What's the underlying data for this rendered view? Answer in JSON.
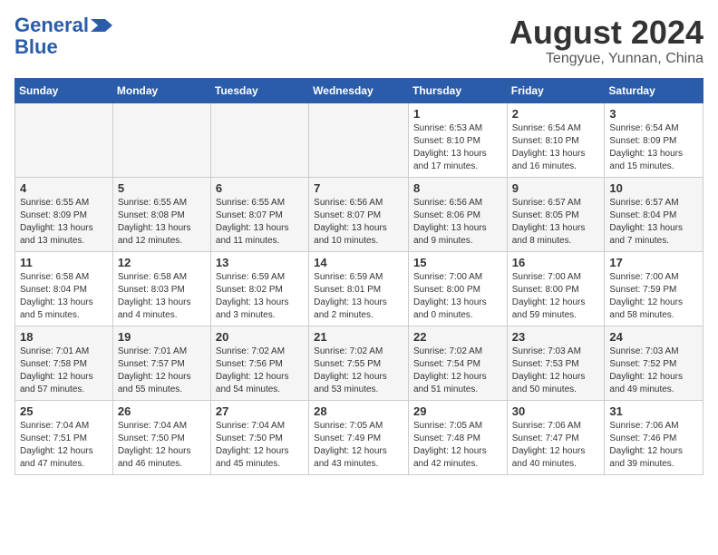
{
  "header": {
    "logo_line1": "General",
    "logo_line2": "Blue",
    "title": "August 2024",
    "subtitle": "Tengyue, Yunnan, China"
  },
  "weekdays": [
    "Sunday",
    "Monday",
    "Tuesday",
    "Wednesday",
    "Thursday",
    "Friday",
    "Saturday"
  ],
  "weeks": [
    [
      {
        "day": "",
        "info": ""
      },
      {
        "day": "",
        "info": ""
      },
      {
        "day": "",
        "info": ""
      },
      {
        "day": "",
        "info": ""
      },
      {
        "day": "1",
        "info": "Sunrise: 6:53 AM\nSunset: 8:10 PM\nDaylight: 13 hours\nand 17 minutes."
      },
      {
        "day": "2",
        "info": "Sunrise: 6:54 AM\nSunset: 8:10 PM\nDaylight: 13 hours\nand 16 minutes."
      },
      {
        "day": "3",
        "info": "Sunrise: 6:54 AM\nSunset: 8:09 PM\nDaylight: 13 hours\nand 15 minutes."
      }
    ],
    [
      {
        "day": "4",
        "info": "Sunrise: 6:55 AM\nSunset: 8:09 PM\nDaylight: 13 hours\nand 13 minutes."
      },
      {
        "day": "5",
        "info": "Sunrise: 6:55 AM\nSunset: 8:08 PM\nDaylight: 13 hours\nand 12 minutes."
      },
      {
        "day": "6",
        "info": "Sunrise: 6:55 AM\nSunset: 8:07 PM\nDaylight: 13 hours\nand 11 minutes."
      },
      {
        "day": "7",
        "info": "Sunrise: 6:56 AM\nSunset: 8:07 PM\nDaylight: 13 hours\nand 10 minutes."
      },
      {
        "day": "8",
        "info": "Sunrise: 6:56 AM\nSunset: 8:06 PM\nDaylight: 13 hours\nand 9 minutes."
      },
      {
        "day": "9",
        "info": "Sunrise: 6:57 AM\nSunset: 8:05 PM\nDaylight: 13 hours\nand 8 minutes."
      },
      {
        "day": "10",
        "info": "Sunrise: 6:57 AM\nSunset: 8:04 PM\nDaylight: 13 hours\nand 7 minutes."
      }
    ],
    [
      {
        "day": "11",
        "info": "Sunrise: 6:58 AM\nSunset: 8:04 PM\nDaylight: 13 hours\nand 5 minutes."
      },
      {
        "day": "12",
        "info": "Sunrise: 6:58 AM\nSunset: 8:03 PM\nDaylight: 13 hours\nand 4 minutes."
      },
      {
        "day": "13",
        "info": "Sunrise: 6:59 AM\nSunset: 8:02 PM\nDaylight: 13 hours\nand 3 minutes."
      },
      {
        "day": "14",
        "info": "Sunrise: 6:59 AM\nSunset: 8:01 PM\nDaylight: 13 hours\nand 2 minutes."
      },
      {
        "day": "15",
        "info": "Sunrise: 7:00 AM\nSunset: 8:00 PM\nDaylight: 13 hours\nand 0 minutes."
      },
      {
        "day": "16",
        "info": "Sunrise: 7:00 AM\nSunset: 8:00 PM\nDaylight: 12 hours\nand 59 minutes."
      },
      {
        "day": "17",
        "info": "Sunrise: 7:00 AM\nSunset: 7:59 PM\nDaylight: 12 hours\nand 58 minutes."
      }
    ],
    [
      {
        "day": "18",
        "info": "Sunrise: 7:01 AM\nSunset: 7:58 PM\nDaylight: 12 hours\nand 57 minutes."
      },
      {
        "day": "19",
        "info": "Sunrise: 7:01 AM\nSunset: 7:57 PM\nDaylight: 12 hours\nand 55 minutes."
      },
      {
        "day": "20",
        "info": "Sunrise: 7:02 AM\nSunset: 7:56 PM\nDaylight: 12 hours\nand 54 minutes."
      },
      {
        "day": "21",
        "info": "Sunrise: 7:02 AM\nSunset: 7:55 PM\nDaylight: 12 hours\nand 53 minutes."
      },
      {
        "day": "22",
        "info": "Sunrise: 7:02 AM\nSunset: 7:54 PM\nDaylight: 12 hours\nand 51 minutes."
      },
      {
        "day": "23",
        "info": "Sunrise: 7:03 AM\nSunset: 7:53 PM\nDaylight: 12 hours\nand 50 minutes."
      },
      {
        "day": "24",
        "info": "Sunrise: 7:03 AM\nSunset: 7:52 PM\nDaylight: 12 hours\nand 49 minutes."
      }
    ],
    [
      {
        "day": "25",
        "info": "Sunrise: 7:04 AM\nSunset: 7:51 PM\nDaylight: 12 hours\nand 47 minutes."
      },
      {
        "day": "26",
        "info": "Sunrise: 7:04 AM\nSunset: 7:50 PM\nDaylight: 12 hours\nand 46 minutes."
      },
      {
        "day": "27",
        "info": "Sunrise: 7:04 AM\nSunset: 7:50 PM\nDaylight: 12 hours\nand 45 minutes."
      },
      {
        "day": "28",
        "info": "Sunrise: 7:05 AM\nSunset: 7:49 PM\nDaylight: 12 hours\nand 43 minutes."
      },
      {
        "day": "29",
        "info": "Sunrise: 7:05 AM\nSunset: 7:48 PM\nDaylight: 12 hours\nand 42 minutes."
      },
      {
        "day": "30",
        "info": "Sunrise: 7:06 AM\nSunset: 7:47 PM\nDaylight: 12 hours\nand 40 minutes."
      },
      {
        "day": "31",
        "info": "Sunrise: 7:06 AM\nSunset: 7:46 PM\nDaylight: 12 hours\nand 39 minutes."
      }
    ]
  ]
}
